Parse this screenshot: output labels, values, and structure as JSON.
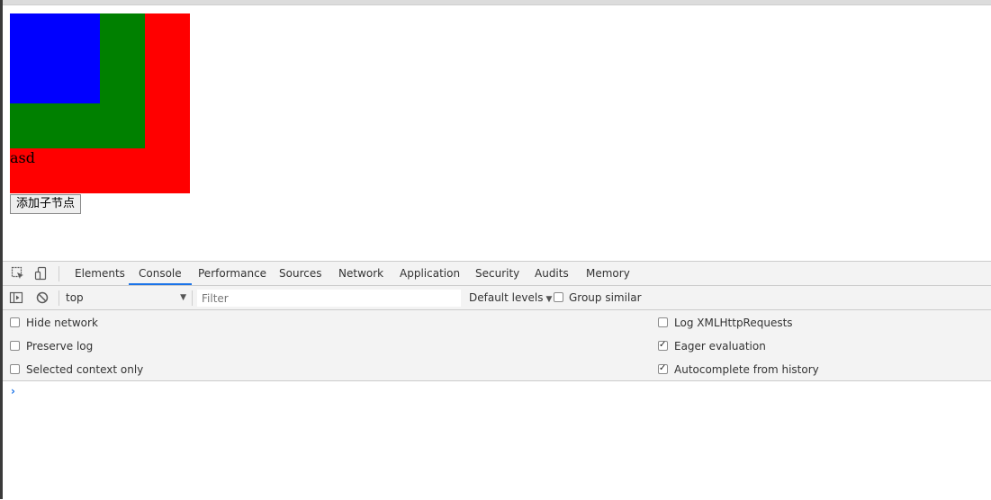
{
  "page": {
    "box_text": "asd",
    "add_button_label": "添加子节点",
    "colors": {
      "outer": "#ff0000",
      "middle": "#008000",
      "inner": "#0000ff"
    }
  },
  "devtools": {
    "tabs": [
      {
        "label": "Elements",
        "active": false
      },
      {
        "label": "Console",
        "active": true
      },
      {
        "label": "Performance",
        "active": false
      },
      {
        "label": "Sources",
        "active": false
      },
      {
        "label": "Network",
        "active": false
      },
      {
        "label": "Application",
        "active": false
      },
      {
        "label": "Security",
        "active": false
      },
      {
        "label": "Audits",
        "active": false
      },
      {
        "label": "Memory",
        "active": false
      }
    ],
    "toolbar": {
      "context": "top",
      "filter_placeholder": "Filter",
      "levels_label": "Default levels",
      "group_similar_label": "Group similar",
      "group_similar_checked": false
    },
    "settings": {
      "left": [
        {
          "label": "Hide network",
          "checked": false
        },
        {
          "label": "Preserve log",
          "checked": false
        },
        {
          "label": "Selected context only",
          "checked": false
        }
      ],
      "right": [
        {
          "label": "Log XMLHttpRequests",
          "checked": false
        },
        {
          "label": "Eager evaluation",
          "checked": true
        },
        {
          "label": "Autocomplete from history",
          "checked": true
        }
      ]
    },
    "prompt_symbol": "›",
    "accent_color": "#1a73e8"
  }
}
